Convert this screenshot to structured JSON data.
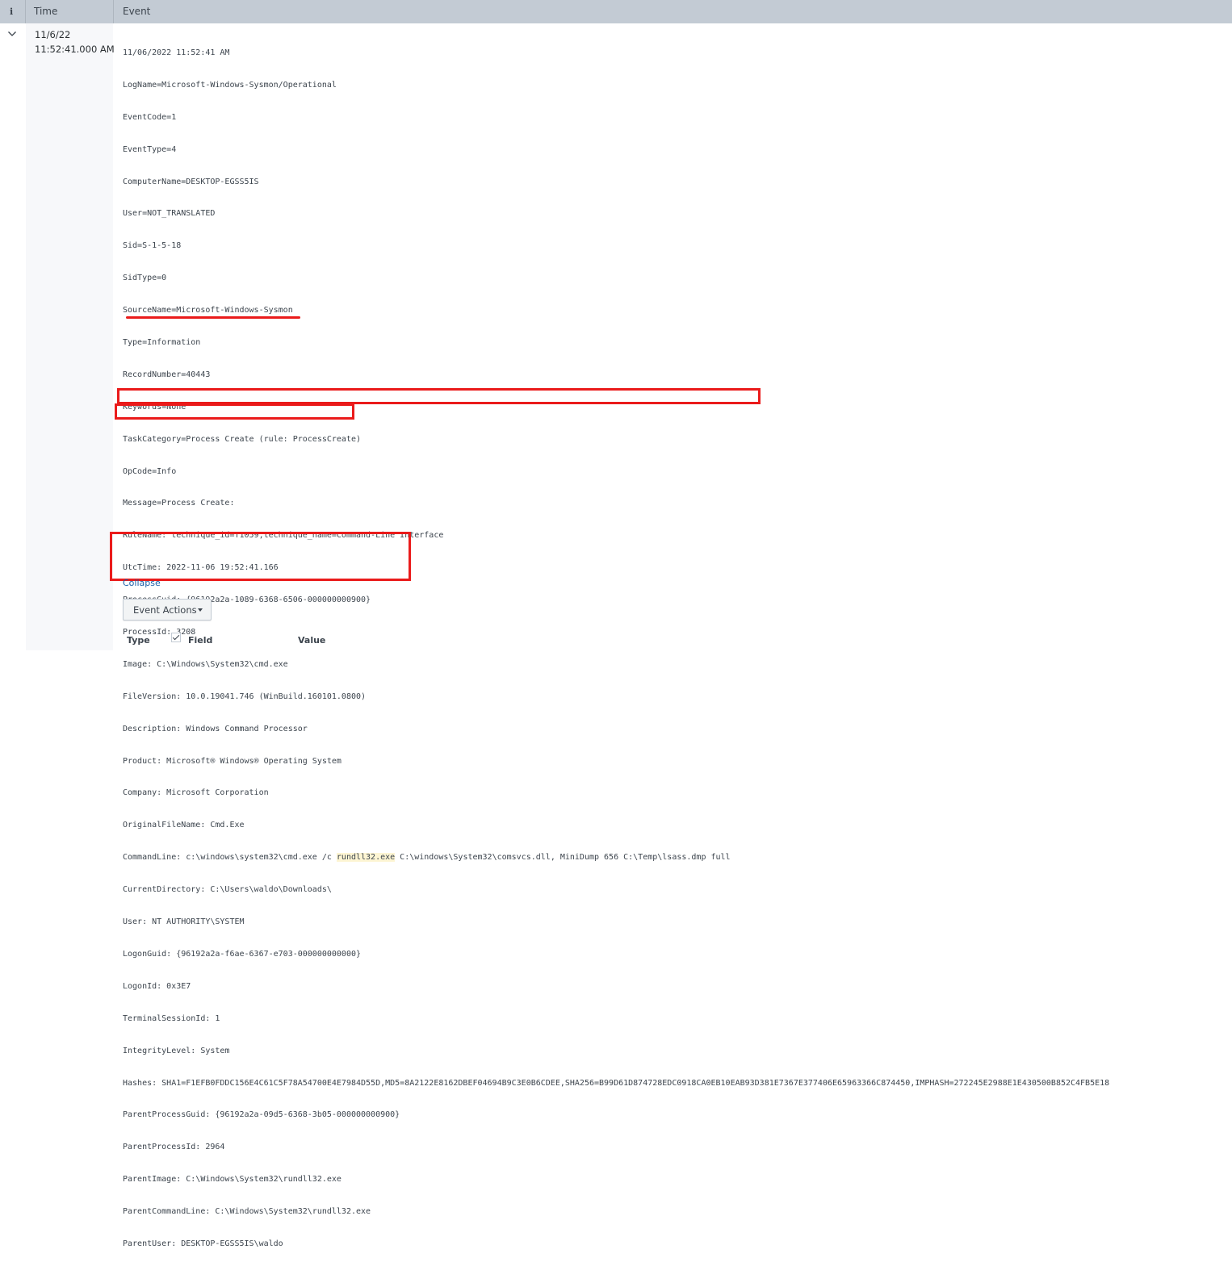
{
  "header": {
    "info_icon_char": "i",
    "time_label": "Time",
    "event_label": "Event"
  },
  "row": {
    "date": "11/6/22",
    "time": "11:52:41.000 AM",
    "lines": [
      "11/06/2022 11:52:41 AM",
      "LogName=Microsoft-Windows-Sysmon/Operational",
      "EventCode=1",
      "EventType=4",
      "ComputerName=DESKTOP-EGSS5IS",
      "User=NOT_TRANSLATED",
      "Sid=S-1-5-18",
      "SidType=0",
      "SourceName=Microsoft-Windows-Sysmon",
      "Type=Information",
      "RecordNumber=40443",
      "Keywords=None",
      "TaskCategory=Process Create (rule: ProcessCreate)",
      "OpCode=Info",
      "Message=Process Create:",
      "RuleName: technique_id=T1059,technique_name=Command-Line Interface",
      "UtcTime: 2022-11-06 19:52:41.166",
      "ProcessGuid: {96192a2a-1089-6368-6506-000000000900}",
      "ProcessId: 3208",
      "Image: C:\\Windows\\System32\\cmd.exe",
      "FileVersion: 10.0.19041.746 (WinBuild.160101.0800)",
      "Description: Windows Command Processor",
      "Product: Microsoft® Windows® Operating System",
      "Company: Microsoft Corporation",
      "OriginalFileName: Cmd.Exe",
      "",
      "CurrentDirectory: C:\\Users\\waldo\\Downloads\\",
      "User: NT AUTHORITY\\SYSTEM",
      "LogonGuid: {96192a2a-f6ae-6367-e703-000000000000}",
      "LogonId: 0x3E7",
      "TerminalSessionId: 1",
      "IntegrityLevel: System",
      "Hashes: SHA1=F1EFB0FDDC156E4C61C5F78A54700E4E7984D55D,MD5=8A2122E8162DBEF04694B9C3E0B6CDEE,SHA256=B99D61D874728EDC0918CA0EB10EAB93D381E7367E377406E65963366C874450,IMPHASH=272245E2988E1E430500B852C4FB5E18",
      "ParentProcessGuid: {96192a2a-09d5-6368-3b05-000000000900}",
      "ParentProcessId: 2964",
      "ParentImage: C:\\Windows\\System32\\rundll32.exe",
      "ParentCommandLine: C:\\Windows\\System32\\rundll32.exe",
      "ParentUser: DESKTOP-EGSS5IS\\waldo"
    ],
    "cmdline": {
      "before": "CommandLine: c:\\windows\\system32\\cmd.exe /c ",
      "highlight": "rundll32.exe",
      "after": " C:\\windows\\System32\\comsvcs.dll, MiniDump 656 C:\\Temp\\lsass.dmp full"
    },
    "collapse_label": "Collapse",
    "event_actions_label": "Event Actions"
  },
  "fields_table": {
    "type_label": "Type",
    "field_label": "Field",
    "value_label": "Value"
  },
  "colors": {
    "annotation_red": "#ea1b1b",
    "header_bg": "#c3cbd4",
    "link_blue": "#1a5fa8"
  }
}
